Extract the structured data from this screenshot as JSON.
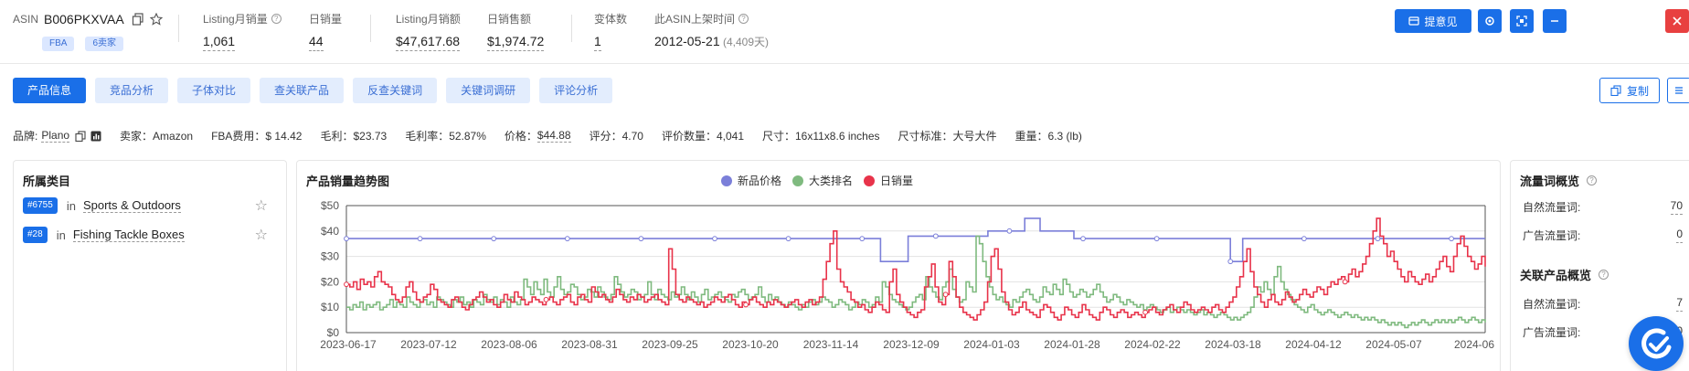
{
  "header": {
    "asin_key": "ASIN",
    "asin_value": "B006PKXVAA",
    "tags": [
      "FBA",
      "6卖家"
    ],
    "metrics": [
      {
        "label": "Listing月销量",
        "value": "1,061",
        "help": true
      },
      {
        "label": "日销量",
        "value": "44",
        "help": false
      },
      {
        "label": "Listing月销额",
        "value": "$47,617.68",
        "help": false
      },
      {
        "label": "日销售额",
        "value": "$1,974.72",
        "help": false
      },
      {
        "label": "变体数",
        "value": "1",
        "help": false
      },
      {
        "label": "此ASIN上架时间",
        "value": "2012-05-21",
        "sub": "(4,409天)",
        "help": true
      }
    ],
    "feedback_button": "提意见"
  },
  "tabs": [
    "产品信息",
    "竞品分析",
    "子体对比",
    "查关联产品",
    "反查关键词",
    "关键词调研",
    "评论分析"
  ],
  "active_tab": "产品信息",
  "copy_button": "复制",
  "attrs": {
    "brand_label": "品牌:",
    "brand_value": "Plano",
    "seller": "卖家：Amazon",
    "fba_fee": "FBA费用：$ 14.42",
    "gross_profit": "毛利：$23.73",
    "gross_margin": "毛利率：52.87%",
    "price_label": "价格：",
    "price_value": "$44.88",
    "rating": "评分：4.70",
    "reviews": "评价数量：4,041",
    "size": "尺寸：16x11x8.6 inches",
    "size_std": "尺寸标准：大号大件",
    "weight": "重量：6.3 (lb)"
  },
  "categories_panel": {
    "title": "所属类目",
    "items": [
      {
        "rank": "#6755",
        "in": "in",
        "name": "Sports & Outdoors"
      },
      {
        "rank": "#28",
        "in": "in",
        "name": "Fishing Tackle Boxes"
      }
    ]
  },
  "traffic_panel": {
    "title1": "流量词概览",
    "rows1": [
      {
        "label": "自然流量词:",
        "value": "70"
      },
      {
        "label": "广告流量词:",
        "value": "0"
      }
    ],
    "title2": "关联产品概览",
    "rows2": [
      {
        "label": "自然流量词:",
        "value": "7"
      },
      {
        "label": "广告流量词:",
        "value": "0"
      }
    ]
  },
  "chart_title": "产品销量趋势图",
  "colors": {
    "price": "#7b7fd9",
    "rank": "#7fba7f",
    "sales": "#e8334a",
    "accent": "#1a6fe8"
  },
  "chart_data": {
    "type": "line",
    "title": "产品销量趋势图",
    "legend_position": "top",
    "legend": [
      "新品价格",
      "大类排名",
      "日销量"
    ],
    "y_ticks": [
      "$0",
      "$10",
      "$20",
      "$30",
      "$40",
      "$50"
    ],
    "ylim": [
      0,
      50
    ],
    "x_ticks": [
      "2023-06-17",
      "2023-07-12",
      "2023-08-06",
      "2023-08-31",
      "2023-09-25",
      "2023-10-20",
      "2023-11-14",
      "2023-12-09",
      "2024-01-03",
      "2024-01-28",
      "2024-02-22",
      "2024-03-18",
      "2024-04-12",
      "2024-05-07",
      "2024-06"
    ],
    "series": [
      {
        "name": "新品价格",
        "values": [
          37,
          37,
          37,
          37,
          37,
          37,
          37,
          37,
          37,
          37,
          37,
          37,
          37,
          37,
          37,
          37,
          37,
          37,
          37,
          37,
          37,
          37,
          37,
          37,
          37,
          37,
          37,
          37,
          37,
          37,
          37,
          37,
          37,
          37,
          37,
          37,
          37,
          37,
          37,
          37,
          37,
          37,
          37,
          37,
          37,
          37,
          37,
          37,
          37,
          37,
          37,
          37,
          37,
          37,
          37,
          37,
          37,
          37,
          37,
          37,
          37,
          37,
          37,
          37,
          37,
          37,
          37,
          37,
          37,
          37,
          37,
          37,
          37,
          37,
          37,
          37,
          37,
          37,
          37,
          37,
          37,
          37,
          37,
          37,
          37,
          37,
          37,
          37,
          37,
          37,
          37,
          37,
          37,
          37,
          37,
          37,
          37,
          37,
          37,
          37,
          37,
          37,
          37,
          37,
          37,
          37,
          37,
          37,
          37,
          37,
          37,
          37,
          37,
          37,
          37,
          37,
          37,
          37,
          37,
          37,
          37,
          37,
          37,
          37,
          37,
          37,
          37,
          37,
          37,
          37,
          37,
          37,
          37,
          37,
          37,
          37,
          37,
          37,
          37,
          37,
          37,
          37,
          37,
          37,
          37,
          37,
          37,
          37,
          37,
          37,
          37,
          37,
          37,
          37,
          37,
          37,
          37,
          37,
          37,
          37,
          37,
          37,
          37,
          37,
          37,
          37,
          37,
          37,
          37,
          37,
          37,
          37,
          37,
          37,
          28,
          28,
          28,
          28,
          28,
          28,
          28,
          28,
          28,
          38,
          38,
          38,
          38,
          38,
          38,
          38,
          38,
          38,
          38,
          38,
          38,
          38,
          38,
          38,
          38,
          38,
          38,
          38,
          38,
          38,
          38,
          38,
          38,
          38,
          38,
          40,
          40,
          40,
          40,
          40,
          40,
          40,
          40,
          40,
          40,
          40,
          40,
          45,
          45,
          45,
          45,
          45,
          40,
          40,
          40,
          40,
          40,
          40,
          40,
          40,
          40,
          40,
          40,
          37,
          37,
          37,
          37,
          37,
          37,
          37,
          37,
          37,
          37,
          37,
          37,
          37,
          37,
          37,
          37,
          37,
          37,
          37,
          37,
          37,
          37,
          37,
          37,
          37,
          37,
          37,
          37,
          37,
          37,
          37,
          37,
          37,
          37,
          37,
          37,
          37,
          37,
          37,
          37,
          37,
          37,
          37,
          37,
          37,
          37,
          37,
          37,
          37,
          37,
          37,
          28,
          28,
          28,
          28,
          37,
          37,
          37,
          37,
          37,
          37,
          37,
          37,
          37,
          37,
          37,
          37,
          37,
          37,
          37,
          37,
          37,
          37,
          37,
          37,
          37,
          37,
          37,
          37,
          37,
          37,
          37,
          37,
          37,
          37,
          37,
          37,
          37,
          37,
          37,
          37,
          37,
          37,
          37,
          37,
          37,
          37,
          37,
          37,
          37,
          37,
          37,
          37,
          37,
          37,
          37,
          37,
          37,
          37,
          37,
          37,
          37,
          37,
          37,
          37,
          37,
          37,
          37,
          37,
          37,
          37,
          37,
          37,
          37,
          37,
          37,
          37,
          37,
          37,
          37,
          37,
          37,
          37,
          37,
          37
        ]
      },
      {
        "name": "大类排名",
        "values": [
          10,
          9,
          11,
          10,
          12,
          9,
          11,
          10,
          11,
          12,
          9,
          10,
          11,
          13,
          10,
          12,
          11,
          10,
          14,
          12,
          11,
          10,
          12,
          13,
          11,
          12,
          10,
          14,
          13,
          12,
          11,
          10,
          13,
          12,
          14,
          11,
          12,
          10,
          13,
          12,
          11,
          15,
          13,
          12,
          14,
          11,
          13,
          12,
          10,
          14,
          12,
          11,
          13,
          21,
          18,
          15,
          20,
          17,
          15,
          21,
          16,
          14,
          18,
          22,
          17,
          15,
          16,
          19,
          18,
          15,
          13,
          14,
          17,
          16,
          14,
          18,
          16,
          14,
          13,
          15,
          22,
          19,
          16,
          14,
          15,
          17,
          16,
          13,
          14,
          15,
          20,
          15,
          13,
          17,
          15,
          14,
          13,
          16,
          14,
          15,
          18,
          15,
          13,
          16,
          14,
          12,
          15,
          17,
          13,
          14,
          15,
          16,
          14,
          13,
          12,
          15,
          14,
          16,
          17,
          15,
          13,
          14,
          15,
          18,
          14,
          12,
          15,
          13,
          14,
          12,
          11,
          10,
          12,
          11,
          10,
          9,
          11,
          10,
          12,
          13,
          11,
          12,
          14,
          13,
          12,
          10,
          11,
          13,
          12,
          11,
          9,
          10,
          12,
          11,
          13,
          12,
          10,
          11,
          14,
          12,
          20,
          18,
          15,
          13,
          12,
          11,
          10,
          9,
          10,
          12,
          14,
          15,
          13,
          22,
          18,
          16,
          14,
          13,
          18,
          20,
          25,
          17,
          14,
          12,
          13,
          20,
          18,
          16,
          38,
          35,
          28,
          22,
          18,
          15,
          13,
          14,
          12,
          11,
          10,
          13,
          12,
          14,
          16,
          17,
          15,
          13,
          12,
          14,
          18,
          16,
          15,
          19,
          17,
          15,
          21,
          19,
          16,
          14,
          15,
          17,
          16,
          14,
          15,
          17,
          19,
          16,
          14,
          12,
          13,
          15,
          14,
          12,
          11,
          13,
          12,
          11,
          10,
          11,
          9,
          10,
          11,
          10,
          9,
          8,
          9,
          10,
          8,
          9,
          10,
          9,
          8,
          9,
          8,
          7,
          8,
          9,
          7,
          8,
          7,
          6,
          7,
          8,
          7,
          6,
          5,
          6,
          5,
          6,
          7,
          8,
          10,
          14,
          18,
          16,
          20,
          17,
          15,
          22,
          26,
          20,
          17,
          15,
          13,
          11,
          10,
          9,
          8,
          10,
          11,
          9,
          8,
          7,
          8,
          9,
          8,
          7,
          6,
          7,
          8,
          7,
          6,
          7,
          6,
          5,
          6,
          5,
          6,
          5,
          4,
          5,
          4,
          3,
          4,
          3,
          4,
          3,
          2,
          3,
          4,
          3,
          4,
          5,
          4,
          3,
          4,
          5,
          4,
          5,
          4,
          5,
          4,
          5,
          6,
          5,
          4,
          5,
          6,
          5,
          4,
          5,
          4
        ]
      },
      {
        "name": "日销量",
        "values": [
          19,
          18,
          20,
          17,
          21,
          19,
          20,
          18,
          22,
          24,
          20,
          19,
          18,
          15,
          13,
          12,
          14,
          18,
          20,
          16,
          13,
          12,
          14,
          15,
          19,
          17,
          13,
          12,
          11,
          10,
          13,
          14,
          12,
          10,
          9,
          11,
          13,
          14,
          16,
          14,
          12,
          13,
          11,
          10,
          12,
          15,
          13,
          12,
          16,
          14,
          13,
          11,
          12,
          14,
          13,
          12,
          11,
          13,
          14,
          12,
          11,
          13,
          14,
          15,
          12,
          11,
          14,
          15,
          13,
          12,
          18,
          16,
          14,
          15,
          13,
          12,
          14,
          17,
          15,
          13,
          12,
          14,
          13,
          15,
          14,
          12,
          13,
          14,
          15,
          13,
          12,
          11,
          33,
          25,
          15,
          13,
          12,
          14,
          13,
          12,
          11,
          12,
          10,
          11,
          12,
          14,
          13,
          12,
          14,
          15,
          13,
          11,
          10,
          12,
          11,
          13,
          14,
          12,
          11,
          10,
          12,
          11,
          13,
          12,
          11,
          10,
          11,
          12,
          13,
          11,
          10,
          12,
          13,
          11,
          12,
          14,
          21,
          28,
          35,
          40,
          25,
          20,
          18,
          16,
          13,
          12,
          10,
          11,
          9,
          8,
          10,
          12,
          11,
          9,
          8,
          20,
          25,
          15,
          12,
          10,
          8,
          7,
          6,
          8,
          9,
          18,
          22,
          27,
          18,
          12,
          11,
          15,
          28,
          22,
          14,
          10,
          8,
          7,
          6,
          5,
          7,
          9,
          12,
          20,
          30,
          33,
          25,
          16,
          12,
          9,
          7,
          8,
          10,
          12,
          9,
          8,
          7,
          6,
          9,
          11,
          10,
          8,
          6,
          5,
          7,
          10,
          9,
          7,
          6,
          8,
          11,
          9,
          7,
          6,
          5,
          8,
          10,
          9,
          7,
          6,
          8,
          9,
          8,
          6,
          7,
          8,
          7,
          6,
          8,
          9,
          10,
          8,
          7,
          9,
          10,
          11,
          9,
          8,
          10,
          12,
          11,
          9,
          8,
          9,
          10,
          9,
          8,
          10,
          11,
          9,
          8,
          10,
          12,
          14,
          18,
          22,
          28,
          33,
          24,
          18,
          15,
          12,
          10,
          13,
          15,
          12,
          11,
          13,
          16,
          14,
          12,
          13,
          15,
          17,
          15,
          14,
          16,
          18,
          17,
          15,
          18,
          20,
          19,
          21,
          22,
          20,
          23,
          25,
          22,
          24,
          27,
          30,
          35,
          40,
          45,
          38,
          35,
          30,
          32,
          28,
          25,
          22,
          20,
          24,
          22,
          20,
          19,
          21,
          23,
          20,
          22,
          25,
          28,
          30,
          26,
          24,
          30,
          35,
          38,
          34,
          30,
          28,
          25,
          27,
          30,
          26
        ]
      }
    ]
  }
}
